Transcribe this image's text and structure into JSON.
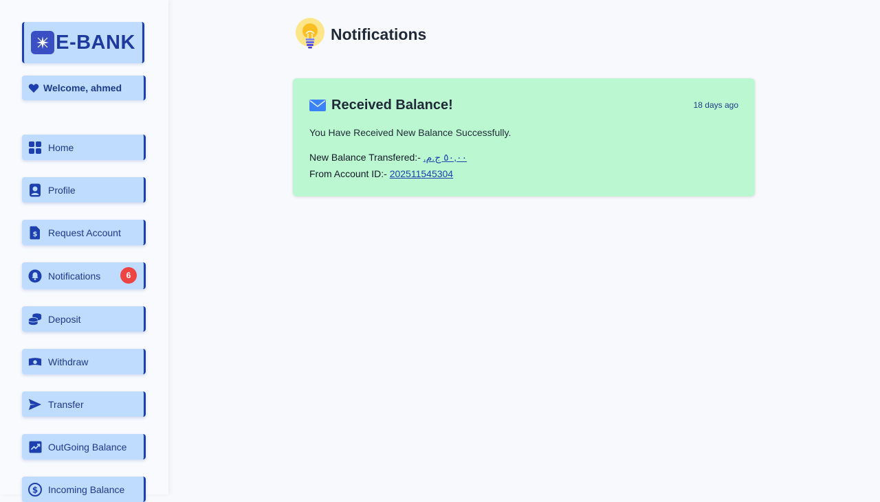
{
  "app": {
    "logo_text": "E-BANK",
    "welcome": "Welcome, ahmed"
  },
  "sidebar": {
    "items": [
      {
        "label": "Home",
        "icon": "home-grid-icon"
      },
      {
        "label": "Profile",
        "icon": "profile-icon"
      },
      {
        "label": "Request Account",
        "icon": "dollar-document-icon"
      },
      {
        "label": "Notifications",
        "icon": "bell-icon",
        "badge": "6"
      },
      {
        "label": "Deposit",
        "icon": "coins-icon"
      },
      {
        "label": "Withdraw",
        "icon": "money-bill-icon"
      },
      {
        "label": "Transfer",
        "icon": "send-icon"
      },
      {
        "label": "OutGoing Balance",
        "icon": "chart-up-icon"
      },
      {
        "label": "Incoming Balance",
        "icon": "dollar-circle-icon"
      }
    ]
  },
  "page": {
    "title": "Notifications",
    "icon": "lightbulb-icon"
  },
  "notification": {
    "icon": "envelope-icon",
    "title": "Received Balance!",
    "time": "18 days ago",
    "message": "You Have Received New Balance Successfully.",
    "amount_label": "New Balance Transfered:-",
    "amount_value": "٥٠,٠٠ ج.م.",
    "account_label": "From Account ID:-",
    "account_value": "202511545304"
  },
  "colors": {
    "accent": "#1e40af",
    "nav_bg": "#bfdbfe",
    "card_bg": "#bbf7d0",
    "badge": "#ef4444"
  }
}
